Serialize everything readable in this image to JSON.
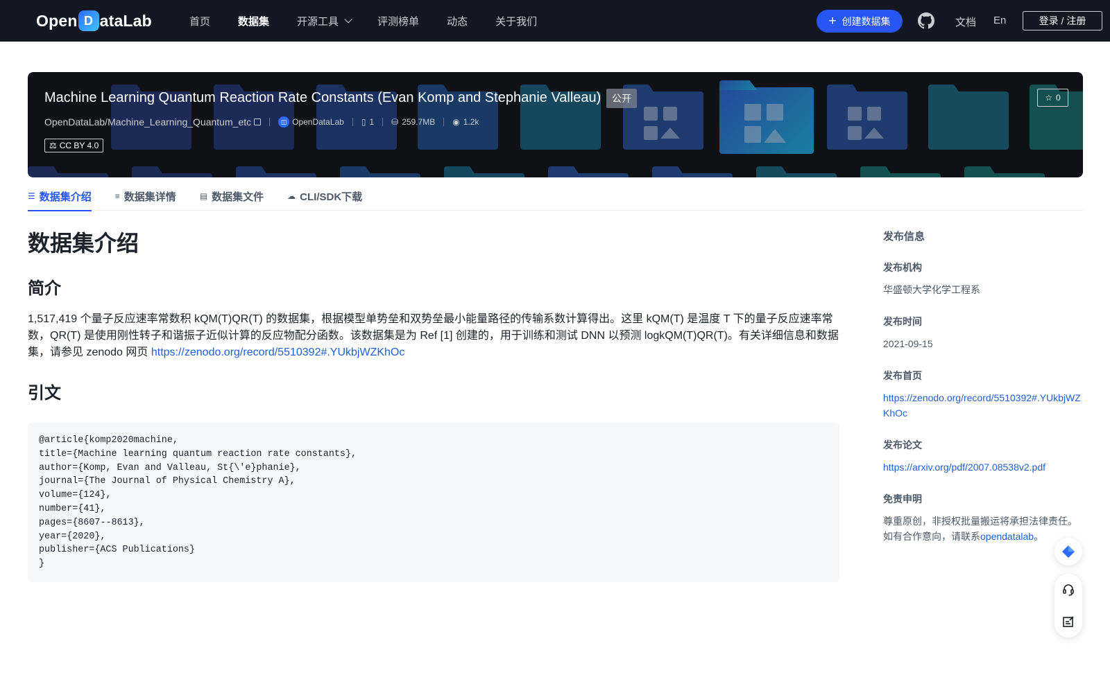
{
  "nav": {
    "logo_text_pre": "Open",
    "logo_mark": "D",
    "logo_text_post": "ataLab",
    "links": [
      "首页",
      "数据集",
      "开源工具",
      "评测榜单",
      "动态",
      "关于我们"
    ],
    "create_button": "创建数据集",
    "github_icon": "github-icon",
    "docs": "文档",
    "lang": "En",
    "login": "登录 / 注册"
  },
  "banner": {
    "title": "Machine Learning Quantum Reaction Rate Constants (Evan Komp and Stephanie Valleau)",
    "visibility": "公开",
    "repo": "OpenDataLab/Machine_Learning_Quantum_etc",
    "org": "OpenDataLab",
    "files": "1",
    "size": "259.7MB",
    "views": "1.2k",
    "license": "CC BY 4.0",
    "stars": "0"
  },
  "tabs": [
    {
      "label": "数据集介绍",
      "icon": "database-icon"
    },
    {
      "label": "数据集详情",
      "icon": "list-icon"
    },
    {
      "label": "数据集文件",
      "icon": "file-icon"
    },
    {
      "label": "CLI/SDK下载",
      "icon": "cloud-download-icon"
    }
  ],
  "main": {
    "title": "数据集介绍",
    "intro_heading": "简介",
    "intro_text": "1,517,419 个量子反应速率常数积 kQM(T)QR(T) 的数据集，根据模型单势垒和双势垒最小能量路径的传输系数计算得出。这里 kQM(T) 是温度 T 下的量子反应速率常数，QR(T) 是使用刚性转子和谐振子近似计算的反应物配分函数。该数据集是为 Ref [1] 创建的，用于训练和测试 DNN 以预测 logkQM(T)QR(T)。有关详细信息和数据集，请参见 zenodo 网页 ",
    "intro_link": "https://zenodo.org/record/5510392#.YUkbjWZKhOc",
    "citation_heading": "引文",
    "citation_code": "@article{komp2020machine,\ntitle={Machine learning quantum reaction rate constants},\nauthor={Komp, Evan and Valleau, St{\\'e}phanie},\njournal={The Journal of Physical Chemistry A},\nvolume={124},\nnumber={41},\npages={8607--8613},\nyear={2020},\npublisher={ACS Publications}\n}"
  },
  "sidebar": {
    "title": "发布信息",
    "publisher_label": "发布机构",
    "publisher": "华盛顿大学化学工程系",
    "date_label": "发布时间",
    "date": "2021-09-15",
    "homepage_label": "发布首页",
    "homepage": "https://zenodo.org/record/5510392#.YUkbjWZKhOc",
    "paper_label": "发布论文",
    "paper": "https://arxiv.org/pdf/2007.08538v2.pdf",
    "disclaimer_label": "免责申明",
    "disclaimer_line1": "尊重原创，非授权批量搬运将承担法律责任。",
    "disclaimer_line2_pre": "如有合作意向，请联系",
    "disclaimer_contact": "opendatalab",
    "disclaimer_line2_post": "。"
  },
  "colors": {
    "nav_bg": "#131722",
    "accent": "#2756f5",
    "link": "#1f5fd8"
  }
}
